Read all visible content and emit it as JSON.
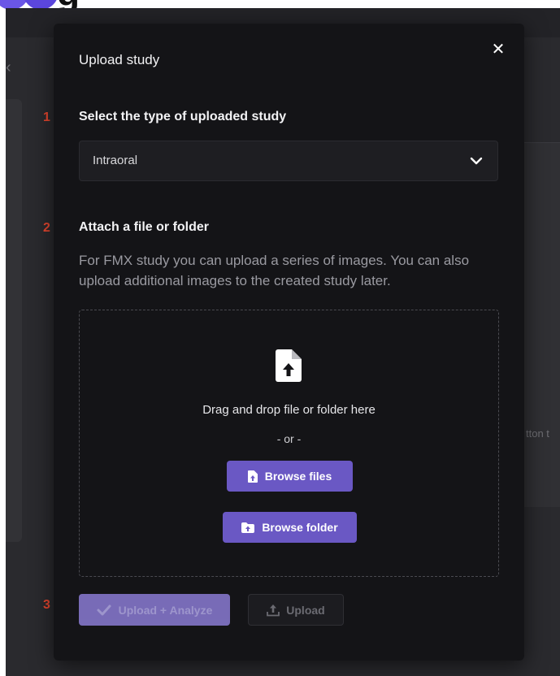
{
  "modal": {
    "title": "Upload study",
    "close_glyph": "✕",
    "steps": [
      "1",
      "2",
      "3"
    ],
    "type_label": "Select the type of uploaded study",
    "type_select": {
      "value": "Intraoral",
      "icon": "chevron-down-icon"
    },
    "attach_label": "Attach a file or folder",
    "description": "For FMX study you can upload a series of images. You can also upload additional images to the created study later.",
    "dropzone": {
      "icon": "file-upload-icon",
      "text": "Drag and drop file or folder here",
      "or": "- or -",
      "browse_files": "Browse files",
      "browse_folder": "Browse folder"
    },
    "actions": {
      "upload_analyze": "Upload + Analyze",
      "upload": "Upload"
    }
  },
  "background": {
    "logo_letter": "g",
    "hint_text": "tton t"
  },
  "colors": {
    "accent": "#6a58c4",
    "step_number": "#e8472f",
    "modal_bg": "#141417",
    "disabled_accent": "#8a7bd4"
  }
}
